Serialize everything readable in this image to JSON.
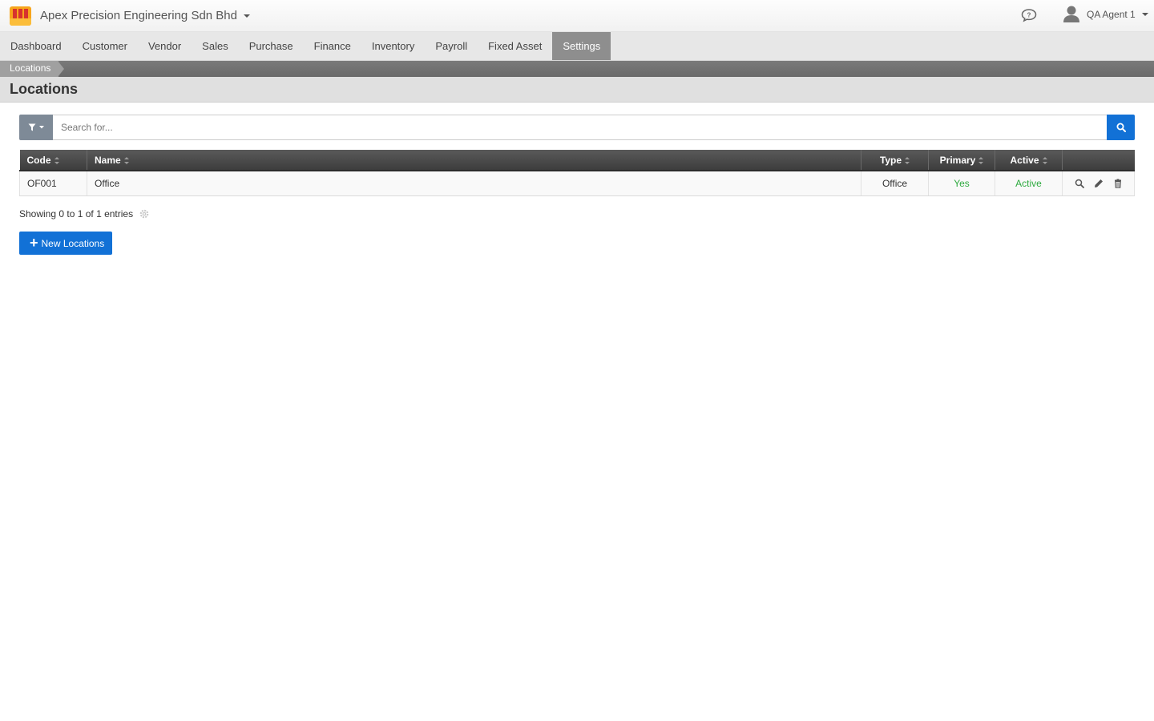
{
  "header": {
    "company": "Apex Precision Engineering Sdn Bhd",
    "user": "QA Agent 1"
  },
  "nav": {
    "items": [
      "Dashboard",
      "Customer",
      "Vendor",
      "Sales",
      "Purchase",
      "Finance",
      "Inventory",
      "Payroll",
      "Fixed Asset",
      "Settings"
    ],
    "active": "Settings"
  },
  "breadcrumb": {
    "current": "Locations"
  },
  "page": {
    "title": "Locations"
  },
  "search": {
    "placeholder": "Search for..."
  },
  "table": {
    "columns": [
      "Code",
      "Name",
      "Type",
      "Primary",
      "Active"
    ],
    "rows": [
      {
        "code": "OF001",
        "name": "Office",
        "type": "Office",
        "primary": "Yes",
        "active": "Active"
      }
    ]
  },
  "footer": {
    "showing": "Showing 0 to 1 of 1 entries",
    "new_button": "New Locations"
  },
  "colors": {
    "primary_blue": "#1271d6",
    "status_green": "#2eaa3f",
    "nav_active": "#8e8e8e"
  },
  "icons": [
    "logo-icon",
    "chat-icon",
    "user-icon",
    "filter-icon",
    "search-icon",
    "view-icon",
    "edit-icon",
    "delete-icon",
    "gear-icon",
    "plus-icon"
  ]
}
